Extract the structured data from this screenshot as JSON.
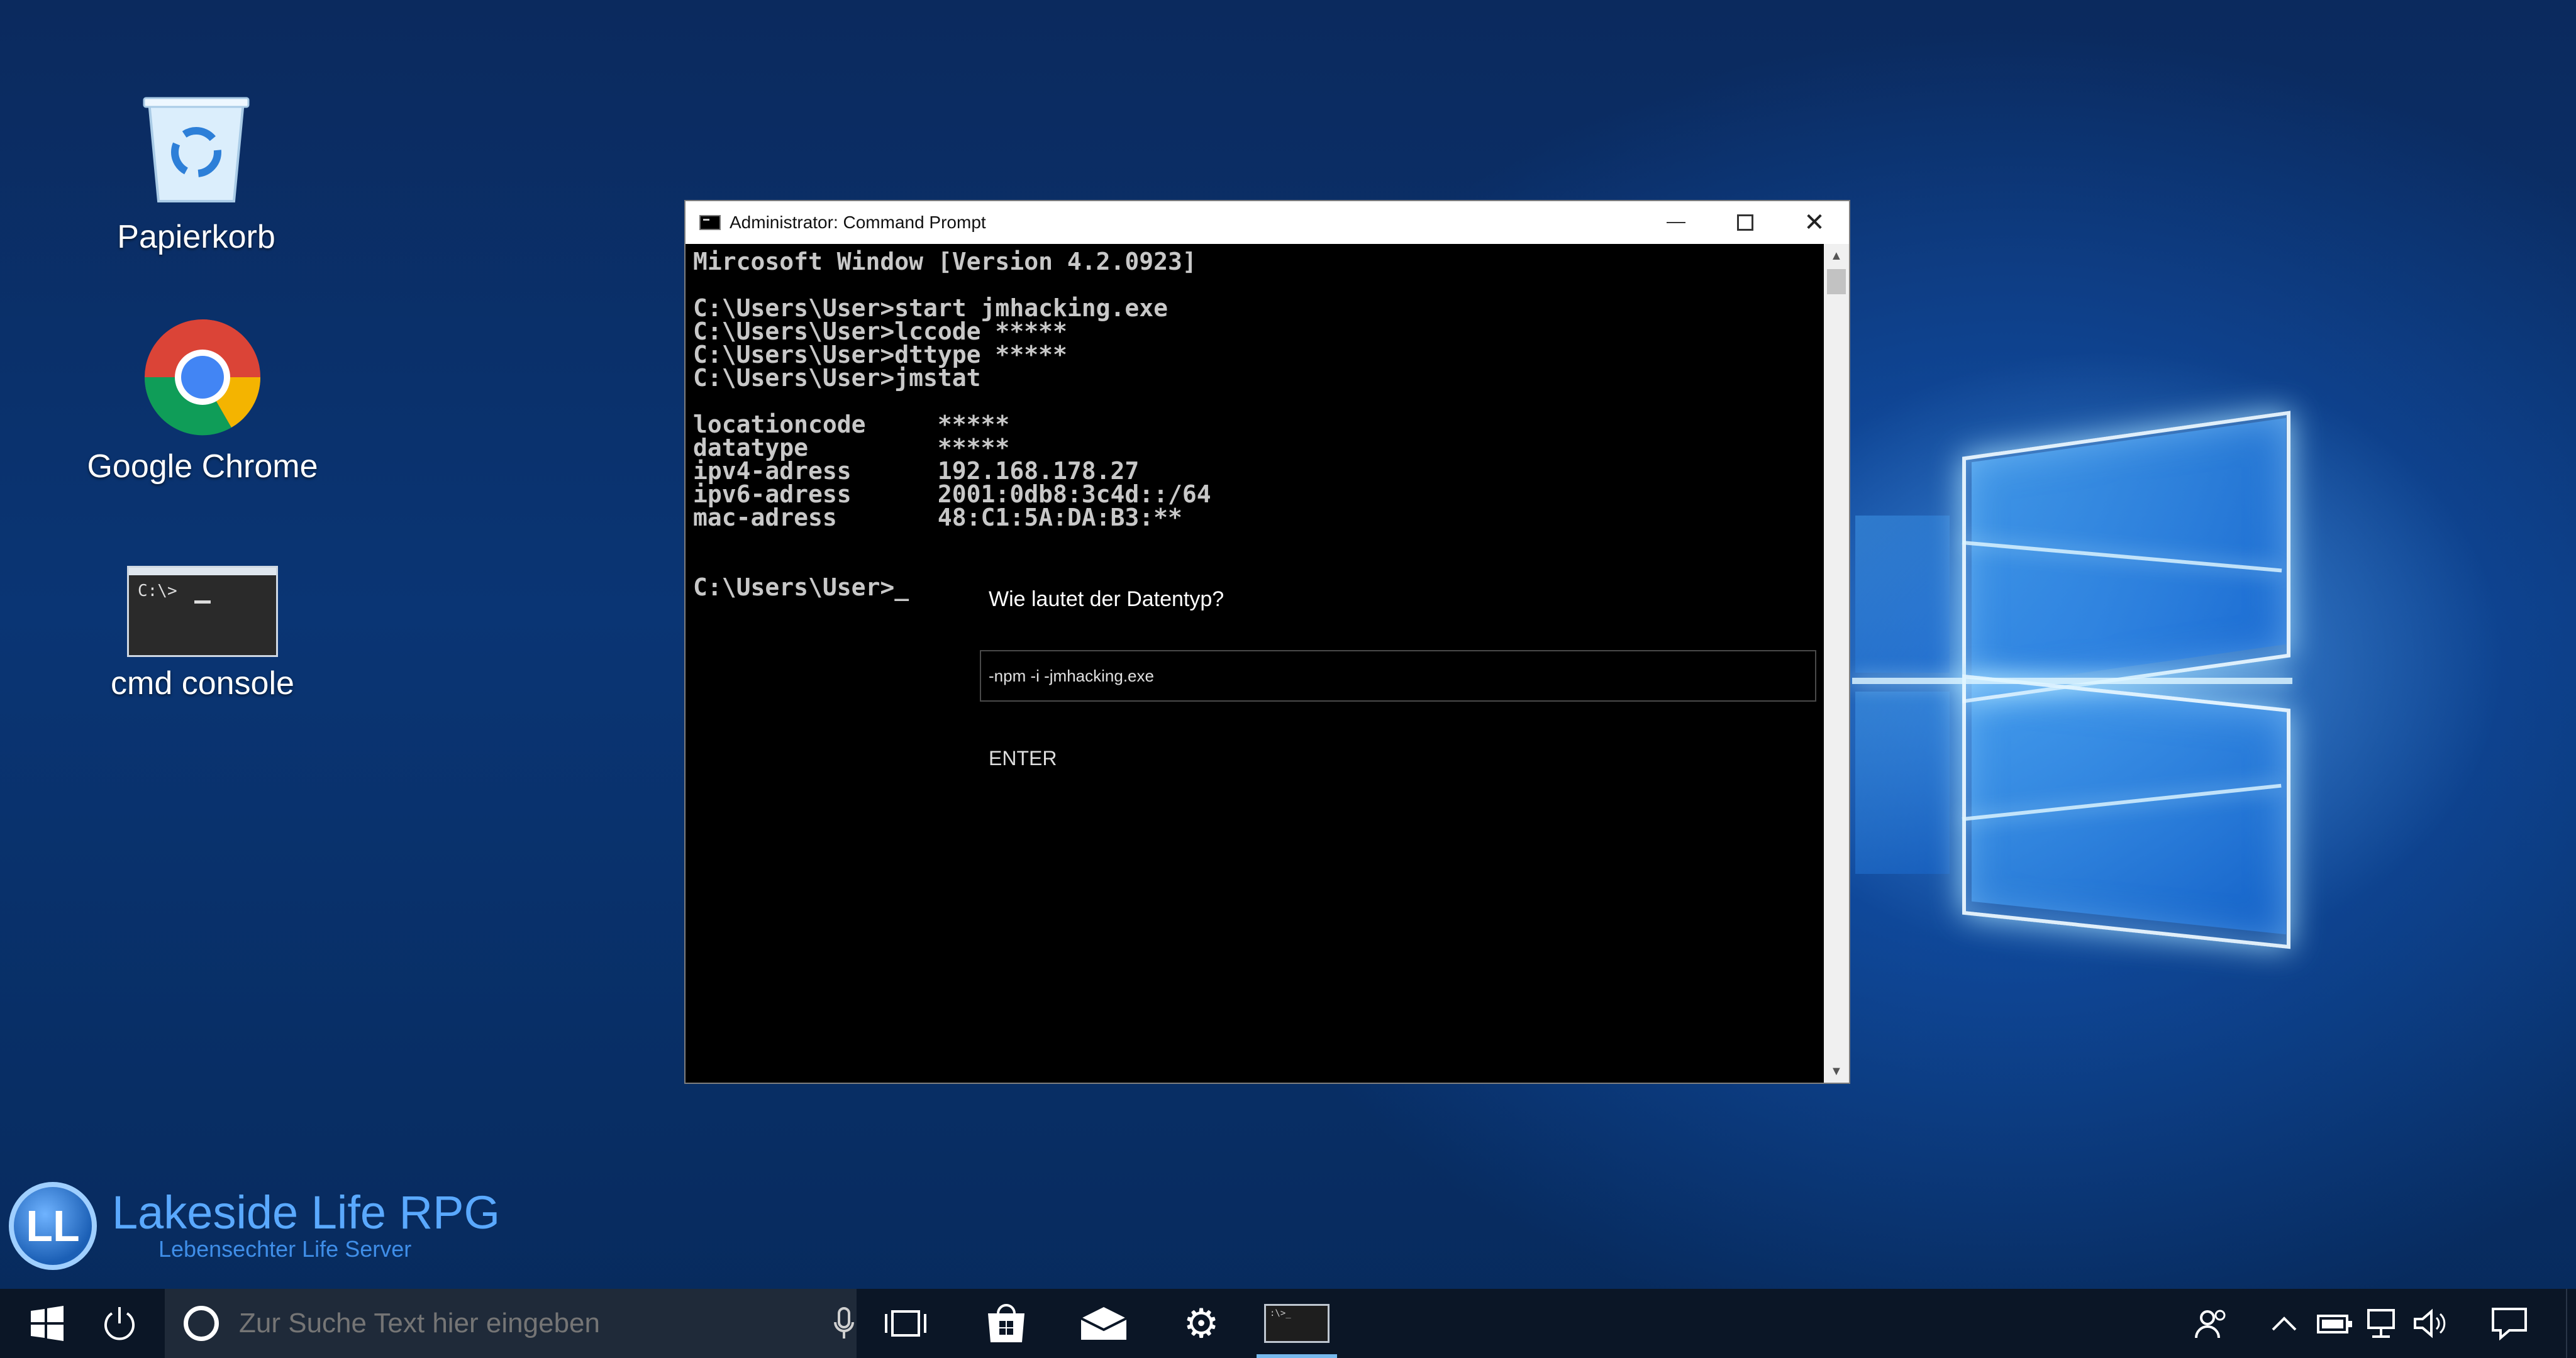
{
  "desktop": {
    "icons": [
      {
        "label": "Papierkorb"
      },
      {
        "label": "Google Chrome"
      },
      {
        "label": "cmd console",
        "thumb_text": "C:\\>"
      }
    ]
  },
  "window": {
    "title": "Administrator: Command Prompt",
    "terminal_text": "Mircosoft Window [Version 4.2.0923]\n\nC:\\Users\\User>start jmhacking.exe\nC:\\Users\\User>lccode *****\nC:\\Users\\User>dttype *****\nC:\\Users\\User>jmstat\n\nlocationcode     *****\ndatatype         *****\nipv4-adress      192.168.178.27\nipv6-adress      2001:0db8:3c4d::/64\nmac-adress       48:C1:5A:DA:B3:**\n\n\nC:\\Users\\User>_",
    "question": "Wie lautet der Datentyp?",
    "answer_value": "-npm -i -jmhacking.exe",
    "enter_label": "ENTER"
  },
  "brand": {
    "seal_text": "LL",
    "name": "Lakeside Life RPG",
    "tagline": "Lebensechter Life Server"
  },
  "taskbar": {
    "search_placeholder": "Zur Suche Text hier eingeben",
    "active_thumb_text": ":\\>_"
  },
  "colors": {
    "terminal_bg": "#000000",
    "terminal_fg": "#c8c8c8",
    "taskbar_bg": "#0b1626",
    "accent_blue": "#5aa9ff"
  }
}
